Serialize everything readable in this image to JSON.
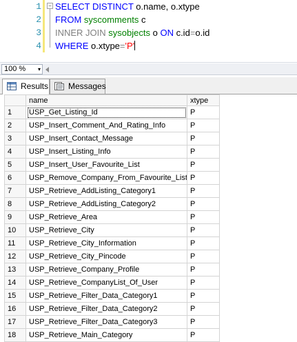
{
  "editor": {
    "line_numbers": [
      "1",
      "2",
      "3",
      "4"
    ],
    "lines": [
      [
        {
          "t": "SELECT DISTINCT",
          "c": "kw"
        },
        {
          "t": " o.name, o.xtype",
          "c": "plain"
        }
      ],
      [
        {
          "t": "FROM",
          "c": "kw"
        },
        {
          "t": " syscomments",
          "c": "obj"
        },
        {
          "t": " c",
          "c": "plain"
        }
      ],
      [
        {
          "t": "INNER JOIN",
          "c": "gray"
        },
        {
          "t": " sysobjects",
          "c": "obj"
        },
        {
          "t": " o ",
          "c": "plain"
        },
        {
          "t": "ON",
          "c": "kw"
        },
        {
          "t": " c.id",
          "c": "plain"
        },
        {
          "t": "=",
          "c": "gray"
        },
        {
          "t": "o.id",
          "c": "plain"
        }
      ],
      [
        {
          "t": "WHERE",
          "c": "kw"
        },
        {
          "t": " o.xtype",
          "c": "plain"
        },
        {
          "t": "=",
          "c": "gray"
        },
        {
          "t": "'P'",
          "c": "str"
        }
      ]
    ]
  },
  "zoom": {
    "value": "100 %",
    "arrow": "▾"
  },
  "tabs": {
    "results": "Results",
    "messages": "Messages"
  },
  "grid": {
    "headers": {
      "rownum": "",
      "name": "name",
      "xtype": "xtype"
    },
    "rows": [
      {
        "n": "1",
        "name": "USP_Get_Listing_Id",
        "xtype": "P"
      },
      {
        "n": "2",
        "name": "USP_Insert_Comment_And_Rating_Info",
        "xtype": "P"
      },
      {
        "n": "3",
        "name": "USP_Insert_Contact_Message",
        "xtype": "P"
      },
      {
        "n": "4",
        "name": "USP_Insert_Listing_Info",
        "xtype": "P"
      },
      {
        "n": "5",
        "name": "USP_Insert_User_Favourite_List",
        "xtype": "P"
      },
      {
        "n": "6",
        "name": "USP_Remove_Company_From_Favourite_List",
        "xtype": "P"
      },
      {
        "n": "7",
        "name": "USP_Retrieve_AddListing_Category1",
        "xtype": "P"
      },
      {
        "n": "8",
        "name": "USP_Retrieve_AddListing_Category2",
        "xtype": "P"
      },
      {
        "n": "9",
        "name": "USP_Retrieve_Area",
        "xtype": "P"
      },
      {
        "n": "10",
        "name": "USP_Retrieve_City",
        "xtype": "P"
      },
      {
        "n": "11",
        "name": "USP_Retrieve_City_Information",
        "xtype": "P"
      },
      {
        "n": "12",
        "name": "USP_Retrieve_City_Pincode",
        "xtype": "P"
      },
      {
        "n": "13",
        "name": "USP_Retrieve_Company_Profile",
        "xtype": "P"
      },
      {
        "n": "14",
        "name": "USP_Retrieve_CompanyList_Of_User",
        "xtype": "P"
      },
      {
        "n": "15",
        "name": "USP_Retrieve_Filter_Data_Category1",
        "xtype": "P"
      },
      {
        "n": "16",
        "name": "USP_Retrieve_Filter_Data_Category2",
        "xtype": "P"
      },
      {
        "n": "17",
        "name": "USP_Retrieve_Filter_Data_Category3",
        "xtype": "P"
      },
      {
        "n": "18",
        "name": "USP_Retrieve_Main_Category",
        "xtype": "P"
      }
    ]
  }
}
